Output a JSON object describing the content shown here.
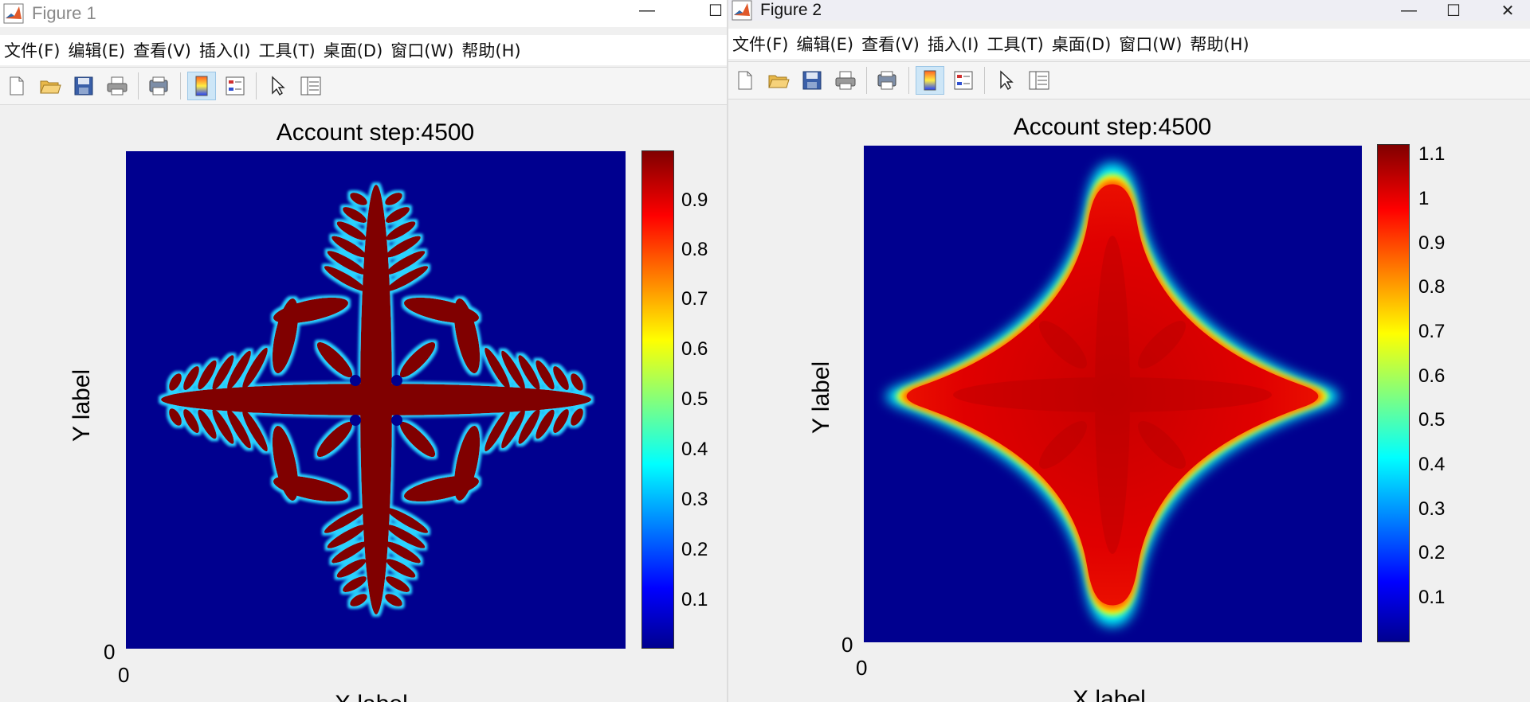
{
  "figures": [
    {
      "title": "Figure 1",
      "menu": [
        "文件(F)",
        "编辑(E)",
        "查看(V)",
        "插入(I)",
        "工具(T)",
        "桌面(D)",
        "窗口(W)",
        "帮助(H)"
      ],
      "axes_title": "Account step:4500",
      "ylabel": "Y label",
      "xlabel": "X label",
      "x_origin": "0",
      "y_origin": "0",
      "colorbar_ticks": [
        "0.9",
        "0.8",
        "0.7",
        "0.6",
        "0.5",
        "0.4",
        "0.3",
        "0.2",
        "0.1"
      ]
    },
    {
      "title": "Figure 2",
      "menu": [
        "文件(F)",
        "编辑(E)",
        "查看(V)",
        "插入(I)",
        "工具(T)",
        "桌面(D)",
        "窗口(W)",
        "帮助(H)"
      ],
      "axes_title": "Account step:4500",
      "ylabel": "Y label",
      "xlabel": "X label",
      "x_origin": "0",
      "y_origin": "0",
      "colorbar_ticks": [
        "1.1",
        "1",
        "0.9",
        "0.8",
        "0.7",
        "0.6",
        "0.5",
        "0.4",
        "0.3",
        "0.2",
        "0.1"
      ]
    }
  ],
  "toolbar_icons": [
    "new-figure-icon",
    "open-file-icon",
    "save-icon",
    "print-icon",
    "print-preview-icon",
    "colorbar-toggle-icon",
    "legend-toggle-icon",
    "edit-plot-arrow-icon",
    "property-inspector-icon"
  ],
  "window_controls": [
    "minimize-icon",
    "maximize-icon",
    "close-icon"
  ],
  "colors": {
    "plot_background": "#00008f",
    "dendrite": "#800000",
    "diffused_fill": "#e60000",
    "menubar_bg": "#ffffff",
    "toolbar_active": "#cde6f7"
  }
}
